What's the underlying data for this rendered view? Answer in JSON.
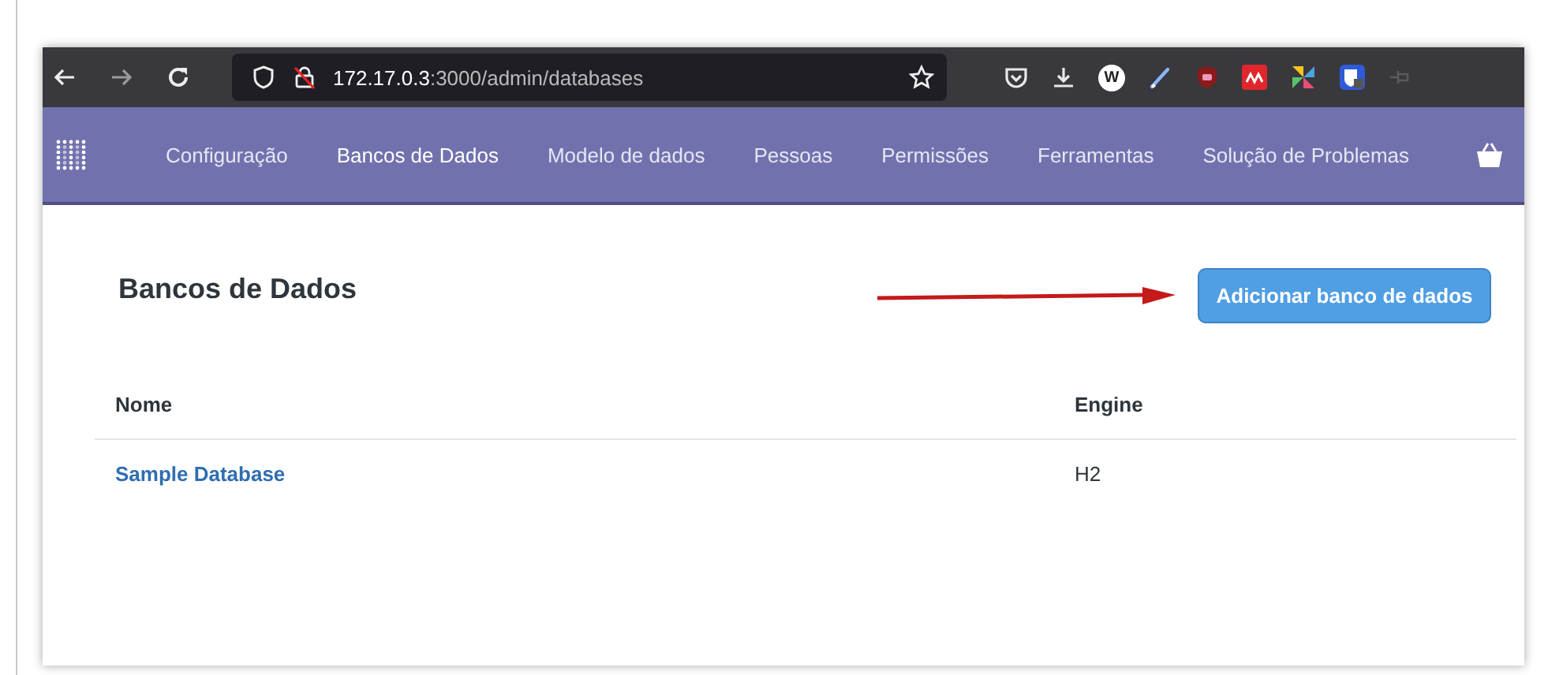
{
  "browser": {
    "address": {
      "host": "172.17.0.3",
      "path": ":3000/admin/databases"
    },
    "extensions": [
      {
        "kind": "pocket"
      },
      {
        "kind": "download"
      },
      {
        "kind": "letter",
        "label": "W"
      },
      {
        "kind": "pen"
      },
      {
        "kind": "shield"
      },
      {
        "kind": "grid"
      },
      {
        "kind": "pinwheel"
      },
      {
        "kind": "lockbox"
      },
      {
        "kind": "pin"
      }
    ]
  },
  "nav": {
    "items": [
      {
        "label": "Configuração",
        "selected": false
      },
      {
        "label": "Bancos de Dados",
        "selected": true
      },
      {
        "label": "Modelo de dados",
        "selected": false
      },
      {
        "label": "Pessoas",
        "selected": false
      },
      {
        "label": "Permissões",
        "selected": false
      },
      {
        "label": "Ferramentas",
        "selected": false
      },
      {
        "label": "Solução de Problemas",
        "selected": false
      }
    ]
  },
  "page": {
    "title": "Bancos de Dados",
    "add_button": "Adicionar banco de dados"
  },
  "table": {
    "columns": [
      "Nome",
      "Engine"
    ],
    "rows": [
      {
        "cells": [
          "Sample Database",
          "H2"
        ]
      }
    ]
  }
}
